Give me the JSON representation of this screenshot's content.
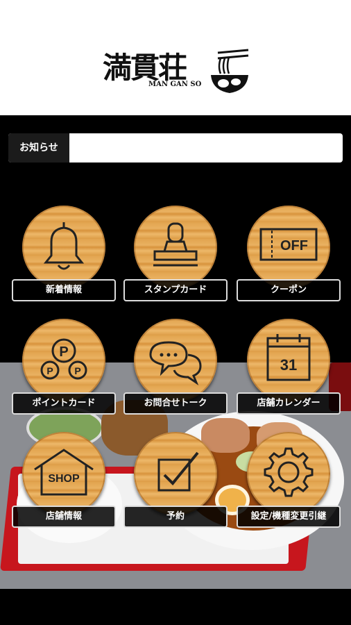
{
  "header": {
    "logo_main": "満貫荘",
    "logo_sub": "MAN GAN SO",
    "logo_icon": "ramen-bowl-icon"
  },
  "notice": {
    "label": "お知らせ",
    "content": ""
  },
  "menu": {
    "items": [
      {
        "label": "新着情報",
        "icon": "bell-icon"
      },
      {
        "label": "スタンプカード",
        "icon": "stamp-icon"
      },
      {
        "label": "クーポン",
        "icon": "coupon-icon",
        "icon_text": "OFF"
      },
      {
        "label": "ポイントカード",
        "icon": "points-icon",
        "icon_text": "P"
      },
      {
        "label": "お問合せトーク",
        "icon": "chat-icon"
      },
      {
        "label": "店舗カレンダー",
        "icon": "calendar-icon",
        "icon_text": "31"
      },
      {
        "label": "店舗情報",
        "icon": "shop-icon",
        "icon_text": "SHOP"
      },
      {
        "label": "予約",
        "icon": "checkbox-icon"
      },
      {
        "label": "設定/機種変更引継",
        "icon": "gear-icon"
      }
    ]
  },
  "colors": {
    "background": "#000000",
    "header_bg": "#ffffff",
    "wood": "#e2a44f",
    "label_border": "#dddddd"
  }
}
